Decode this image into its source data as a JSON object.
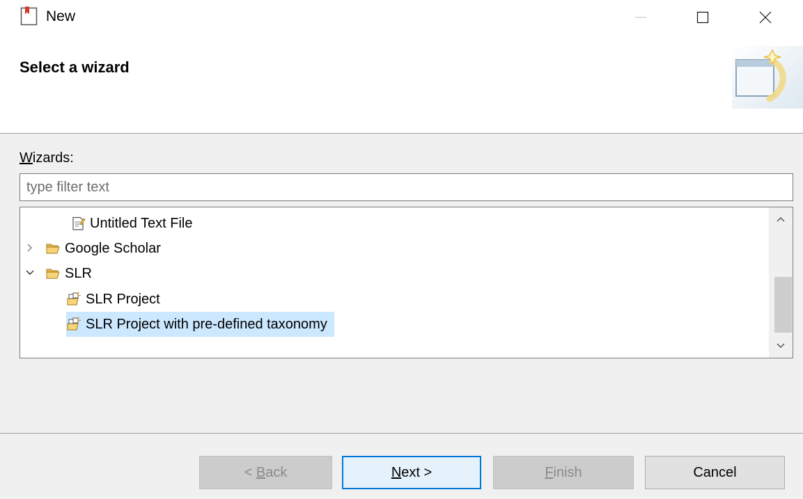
{
  "window": {
    "title": "New"
  },
  "header": {
    "title": "Select a wizard"
  },
  "wizards_label": {
    "accel": "W",
    "rest": "izards:"
  },
  "filter": {
    "placeholder": "type filter text",
    "value": ""
  },
  "tree": {
    "items": [
      {
        "label": "Untitled Text File",
        "icon": "text-file-icon",
        "expander": null,
        "selected": false
      },
      {
        "label": "Google Scholar",
        "icon": "folder-icon",
        "expander": "collapsed",
        "selected": false
      },
      {
        "label": "SLR",
        "icon": "folder-icon",
        "expander": "expanded",
        "selected": false
      },
      {
        "label": "SLR Project",
        "icon": "slr-project-icon",
        "expander": null,
        "selected": false
      },
      {
        "label": "SLR Project with pre-defined taxonomy",
        "icon": "slr-project-icon",
        "expander": null,
        "selected": true
      }
    ]
  },
  "buttons": {
    "back": {
      "prefix": "< ",
      "accel": "B",
      "rest": "ack",
      "enabled": false
    },
    "next": {
      "accel": "N",
      "rest": "ext >",
      "enabled": true
    },
    "finish": {
      "accel": "F",
      "rest": "inish",
      "enabled": false
    },
    "cancel": {
      "label": "Cancel",
      "enabled": true
    }
  },
  "colors": {
    "selection": "#cce8ff",
    "default_button_border": "#0078d7",
    "folder": "#e8b84a"
  }
}
